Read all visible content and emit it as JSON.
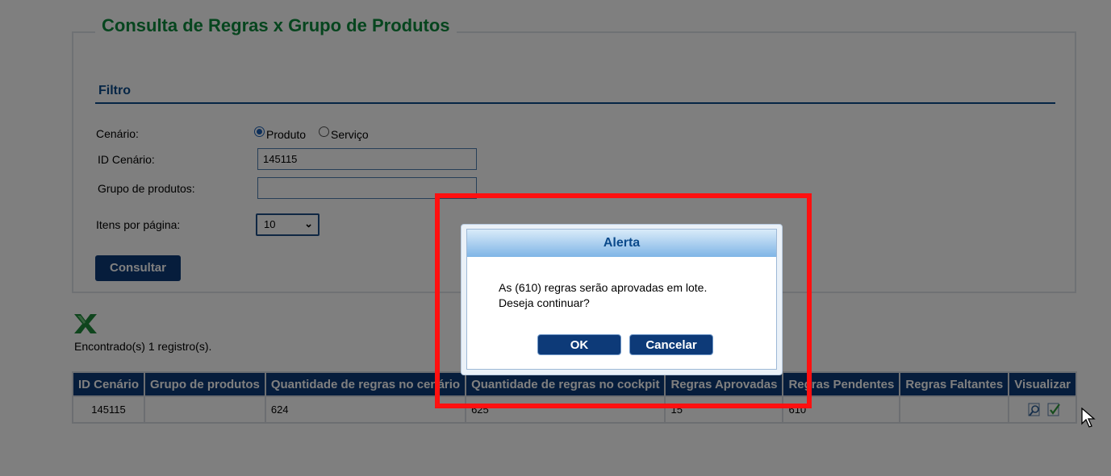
{
  "page": {
    "title": "Consulta de Regras x Grupo de Produtos",
    "filter_title": "Filtro"
  },
  "form": {
    "cenario_label": "Cenário:",
    "radio_produto": "Produto",
    "radio_servico": "Serviço",
    "id_cenario_label": "ID Cenário:",
    "id_cenario_value": "145115",
    "grupo_label": "Grupo de produtos:",
    "grupo_value": "",
    "itens_label": "Itens por página:",
    "itens_value": "10",
    "consultar_label": "Consultar"
  },
  "results": {
    "export_icon": "excel-icon",
    "found_text": "Encontrado(s) 1 registro(s)."
  },
  "table": {
    "headers": [
      "ID Cenário",
      "Grupo de produtos",
      "Quantidade de regras no cenário",
      "Quantidade de regras no cockpit",
      "Regras Aprovadas",
      "Regras Pendentes",
      "Regras Faltantes",
      "Visualizar"
    ],
    "rows": [
      [
        "145115",
        "",
        "624",
        "625",
        "15",
        "610",
        ""
      ]
    ]
  },
  "dialog": {
    "title": "Alerta",
    "line1": "As (610) regras serão aprovadas em lote.",
    "line2": "Deseja continuar?",
    "ok_label": "OK",
    "cancel_label": "Cancelar"
  },
  "colors": {
    "title_green": "#0c8a3c",
    "navy": "#0d3a78",
    "highlight_red": "#ff1010"
  }
}
